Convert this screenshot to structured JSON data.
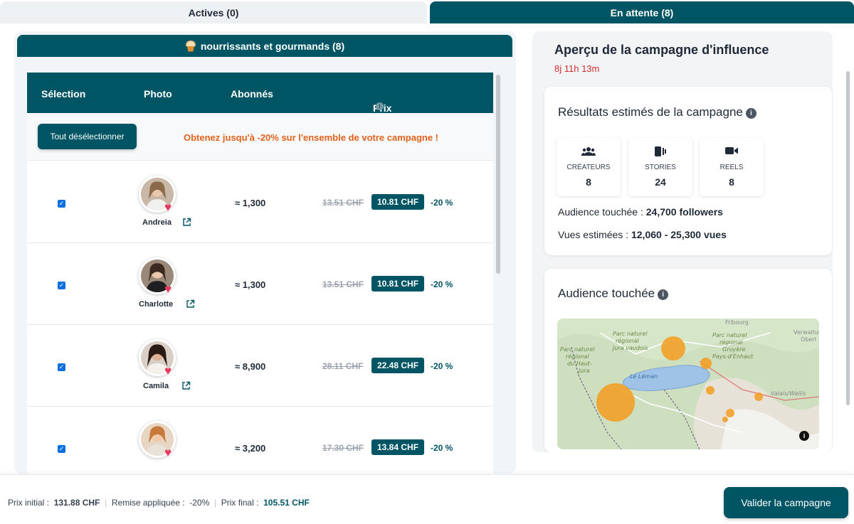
{
  "tabs": [
    {
      "label": "Actives (0)",
      "active": false
    },
    {
      "label": "En attente (8)",
      "active": true
    }
  ],
  "group": {
    "title": "nourrissants et gourmands (8)",
    "icon": "cupcake-icon"
  },
  "table": {
    "headers": {
      "selection": "Sélection",
      "photo": "Photo",
      "subscribers": "Abonnés",
      "price": "Prix"
    },
    "deselect_button": "Tout désélectionner",
    "promo": "Obtenez jusqu'à -20% sur l'ensemble de votre campagne !",
    "rows": [
      {
        "name": "Andreia",
        "followers": "≈ 1,300",
        "old_price": "13.51 CHF",
        "new_price": "10.81 CHF",
        "discount": "-20 %",
        "checked": true
      },
      {
        "name": "Charlotte",
        "followers": "≈ 1,300",
        "old_price": "13.51 CHF",
        "new_price": "10.81 CHF",
        "discount": "-20 %",
        "checked": true
      },
      {
        "name": "Camila",
        "followers": "≈ 8,900",
        "old_price": "28.11 CHF",
        "new_price": "22.48 CHF",
        "discount": "-20 %",
        "checked": true
      },
      {
        "name": "",
        "followers": "≈ 3,200",
        "old_price": "17.30 CHF",
        "new_price": "13.84 CHF",
        "discount": "-20 %",
        "checked": true
      }
    ]
  },
  "overview": {
    "title": "Aperçu de la campagne d'influence",
    "timer": "8j 11h 13m"
  },
  "results": {
    "title": "Résultats estimés de la campagne",
    "stats": [
      {
        "label": "CRÉATEURS",
        "value": "8",
        "icon": "users-icon"
      },
      {
        "label": "STORIES",
        "value": "24",
        "icon": "stories-icon"
      },
      {
        "label": "REELS",
        "value": "8",
        "icon": "video-icon"
      }
    ],
    "audience_label": "Audience touchée :",
    "audience_value": "24,700 followers",
    "views_label": "Vues estimées :",
    "views_value": "12,060 - 25,300 vues"
  },
  "audience": {
    "title": "Audience touchée",
    "map_labels": [
      "Parc naturel régional Jura vaudois",
      "Parc naturel régional du Haut-Jura",
      "Parc naturel régional Gruyère Pays-d'Enhaut",
      "Le Léman",
      "Valais/Wallis",
      "Verwaltung Oberl",
      "Fribourg"
    ]
  },
  "footer": {
    "initial_label": "Prix initial :",
    "initial_value": "131.88 CHF",
    "discount_label": "Remise appliquée :",
    "discount_value": "-20%",
    "final_label": "Prix final :",
    "final_value": "105.51 CHF",
    "validate_button": "Valider la campagne"
  },
  "colors": {
    "primary": "#005565",
    "promo": "#e0621b",
    "timer": "#d22d2d",
    "bubble": "#f39c1f"
  }
}
